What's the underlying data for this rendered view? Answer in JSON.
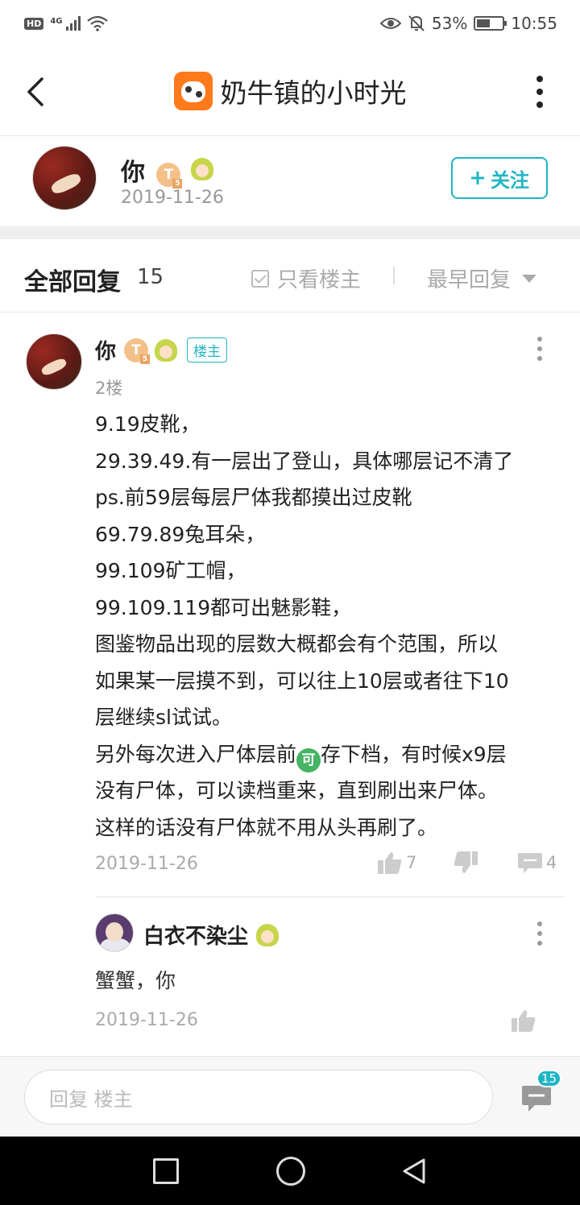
{
  "status_bar": {
    "hd": "HD",
    "network": "4G",
    "battery_pct": "53%",
    "battery_level": 0.53,
    "time": "10:55",
    "icons": [
      "eye-comfort-icon",
      "alarm-off-icon",
      "wifi-icon",
      "signal-icon",
      "battery-icon"
    ]
  },
  "header": {
    "title": "奶牛镇的小时光",
    "app_icon": "moo-town-game-icon",
    "back_icon": "chevron-left-icon",
    "more_icon": "more-vertical-icon"
  },
  "author": {
    "name": "你",
    "date": "2019-11-26",
    "badge_level": "T",
    "badge_sub": "5",
    "follow_label": "关注",
    "follow_icon": "plus-icon"
  },
  "replies_header": {
    "title": "全部回复",
    "count": "15",
    "only_op_label": "只看楼主",
    "sort_label": "最早回复"
  },
  "comment": {
    "name": "你",
    "badge_level": "T",
    "badge_sub": "5",
    "op_tag": "楼主",
    "floor": "2楼",
    "lines": [
      "9.19皮靴，",
      "29.39.49.有一层出了登山，具体哪层记不清了",
      "ps.前59层每层尸体我都摸出过皮靴",
      "69.79.89兔耳朵，",
      "99.109矿工帽，",
      "99.109.119都可出魅影鞋，",
      "图鉴物品出现的层数大概都会有个范围，所以",
      "如果某一层摸不到，可以往上10层或者往下10",
      "层继续sl试试。",
      "另外每次进入尸体层前",
      "存下档，有时候x9层",
      "没有尸体，可以读档重来，直到刷出来尸体。",
      "这样的话没有尸体就不用从头再刷了。"
    ],
    "emoji_text": "可",
    "date": "2019-11-26",
    "likes": "7",
    "replies": "4"
  },
  "sub_reply": {
    "name": "白衣不染尘",
    "text": "蟹蟹，你",
    "date": "2019-11-26"
  },
  "reply_bar": {
    "placeholder": "回复  楼主",
    "count": "15"
  },
  "colors": {
    "accent": "#1fb5c4",
    "gray_text": "#999999",
    "band": "#efefef"
  }
}
